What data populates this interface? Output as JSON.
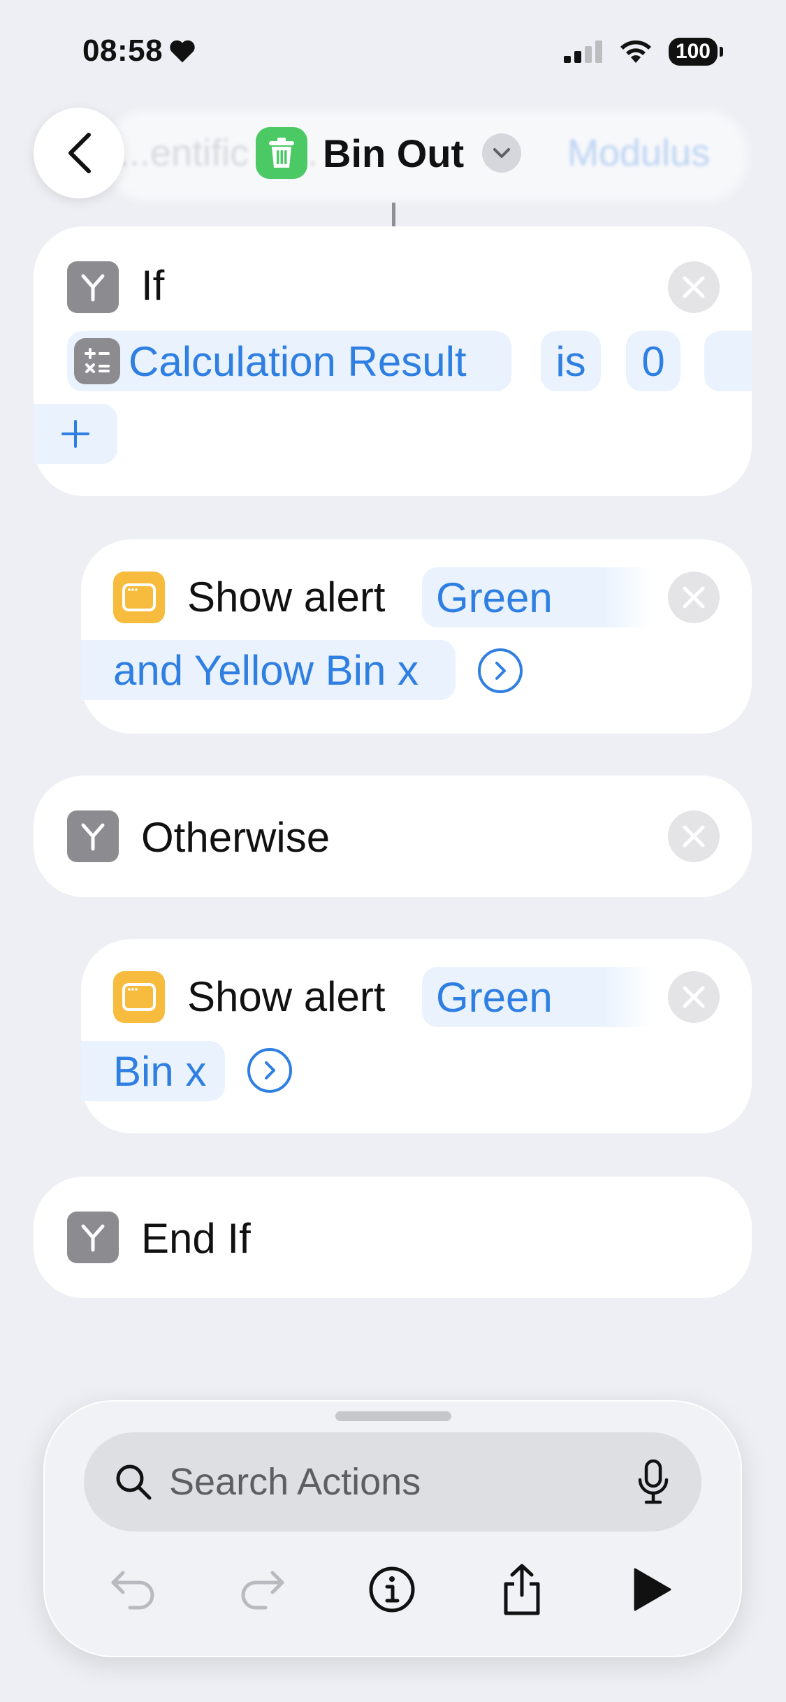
{
  "status_bar": {
    "time": "08:58",
    "battery": "100"
  },
  "header": {
    "title": "Bin Out",
    "ghost_left_text": "...entific C...",
    "ghost_right_text": "Modulus"
  },
  "actions": {
    "if_block": {
      "label": "If",
      "variable": "Calculation Result",
      "condition": "is",
      "value": "0"
    },
    "alert1": {
      "label": "Show alert",
      "message_line1": "Green",
      "message_line2": "and Yellow Bin x"
    },
    "otherwise": {
      "label": "Otherwise"
    },
    "alert2": {
      "label": "Show alert",
      "message_line1": "Green",
      "message_line2": "Bin x"
    },
    "end_if": {
      "label": "End If"
    }
  },
  "search": {
    "placeholder": "Search Actions"
  },
  "colors": {
    "accent": "#2f7fe3",
    "app_icon": "#4bc964",
    "alert_icon": "#f7bc3d",
    "control_icon": "#8b8b90"
  }
}
